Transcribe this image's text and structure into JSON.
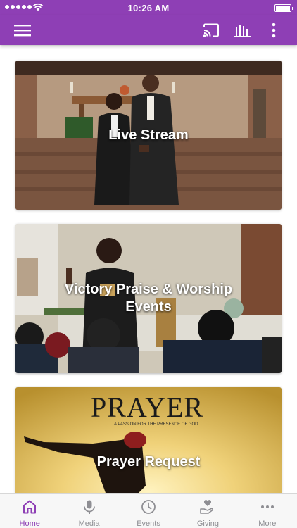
{
  "status_bar": {
    "time": "10:26 AM"
  },
  "app_bar": {
    "menu_icon": "hamburger-menu-icon",
    "actions": [
      "cast-icon",
      "audio-bars-icon",
      "vertical-dots-icon"
    ]
  },
  "cards": [
    {
      "title": "Live Stream",
      "image": "church-couple-at-altar"
    },
    {
      "title": "Victory Praise & Worship Events",
      "image": "woman-speaking-at-event"
    },
    {
      "title": "Prayer Request",
      "image": "prayer-banner-sunset"
    }
  ],
  "tabs": [
    {
      "label": "Home",
      "icon": "home-icon",
      "active": true
    },
    {
      "label": "Media",
      "icon": "microphone-icon",
      "active": false
    },
    {
      "label": "Events",
      "icon": "clock-icon",
      "active": false
    },
    {
      "label": "Giving",
      "icon": "giving-hand-icon",
      "active": false
    },
    {
      "label": "More",
      "icon": "more-dots-icon",
      "active": false
    }
  ],
  "colors": {
    "brand": "#8e3fb5",
    "tab_inactive": "#8e8e93",
    "tab_bar_bg": "#f7f7f7"
  },
  "images": {
    "prayer_banner": {
      "headline": "PRAYER",
      "subline": "A PASSION FOR THE PRESENCE OF GOD"
    }
  }
}
